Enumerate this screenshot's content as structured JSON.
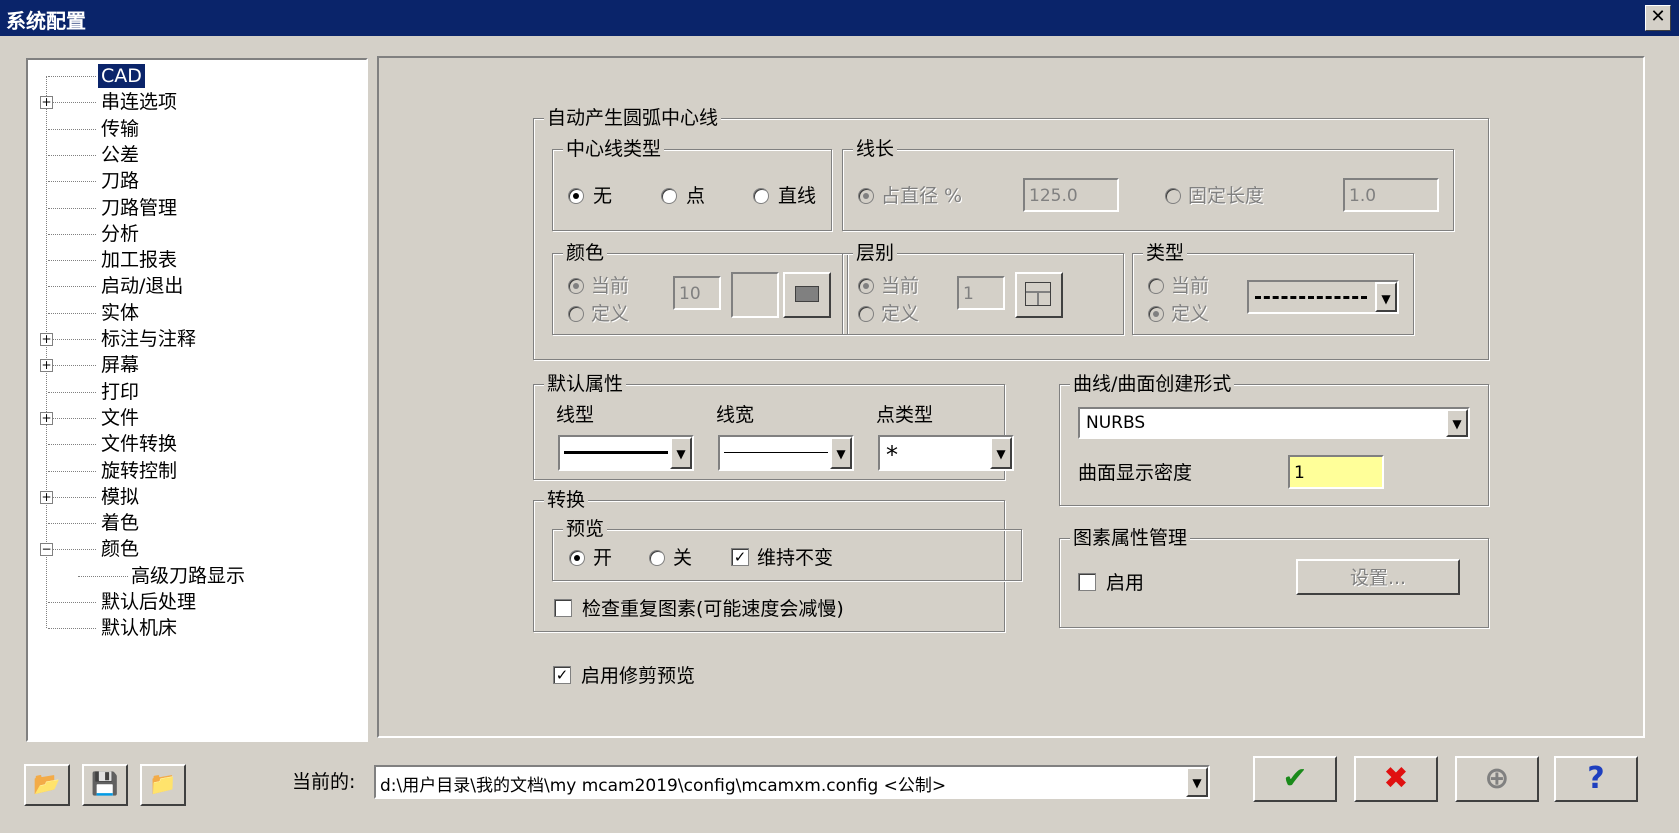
{
  "window": {
    "title": "系统配置",
    "close_glyph": "✕"
  },
  "tree": [
    {
      "label": "CAD",
      "expander": "",
      "selected": true
    },
    {
      "label": "串连选项",
      "expander": "+"
    },
    {
      "label": "传输",
      "expander": ""
    },
    {
      "label": "公差",
      "expander": ""
    },
    {
      "label": "刀路",
      "expander": ""
    },
    {
      "label": "刀路管理",
      "expander": ""
    },
    {
      "label": "分析",
      "expander": ""
    },
    {
      "label": "加工报表",
      "expander": ""
    },
    {
      "label": "启动/退出",
      "expander": ""
    },
    {
      "label": "实体",
      "expander": ""
    },
    {
      "label": "标注与注释",
      "expander": "+"
    },
    {
      "label": "屏幕",
      "expander": "+"
    },
    {
      "label": "打印",
      "expander": ""
    },
    {
      "label": "文件",
      "expander": "+"
    },
    {
      "label": "文件转换",
      "expander": ""
    },
    {
      "label": "旋转控制",
      "expander": ""
    },
    {
      "label": "模拟",
      "expander": "+"
    },
    {
      "label": "着色",
      "expander": ""
    },
    {
      "label": "颜色",
      "expander": "−"
    },
    {
      "label": "高级刀路显示",
      "expander": "",
      "child": true
    },
    {
      "label": "默认后处理",
      "expander": ""
    },
    {
      "label": "默认机床",
      "expander": ""
    }
  ],
  "arc": {
    "title": "自动产生圆弧中心线",
    "centerline_type": {
      "title": "中心线类型",
      "options": [
        "无",
        "点",
        "直线"
      ],
      "selected": "无"
    },
    "length": {
      "title": "线长",
      "pct_label": "占直径 %",
      "pct_value": "125.0",
      "fixed_label": "固定长度",
      "fixed_value": "1.0"
    },
    "color": {
      "title": "颜色",
      "current": "当前",
      "define": "定义",
      "value": "10"
    },
    "level": {
      "title": "层别",
      "current": "当前",
      "define": "定义",
      "value": "1"
    },
    "type": {
      "title": "类型",
      "current": "当前",
      "define": "定义"
    }
  },
  "defaults": {
    "title": "默认属性",
    "linetype_label": "线型",
    "linewidth_label": "线宽",
    "pointtype_label": "点类型",
    "point_glyph": "*"
  },
  "surface": {
    "title": "曲线/曲面创建形式",
    "form_value": "NURBS",
    "density_label": "曲面显示密度",
    "density_value": "1"
  },
  "convert": {
    "title": "转换",
    "preview_title": "预览",
    "on": "开",
    "off": "关",
    "keep": "维持不变",
    "check_dup": "检查重复图素(可能速度会减慢)"
  },
  "entity_attr": {
    "title": "图素属性管理",
    "enable": "启用",
    "settings": "设置..."
  },
  "trim_preview": "启用修剪预览",
  "bottom": {
    "current_label": "当前的:",
    "path": "d:\\用户目录\\我的文档\\my mcam2019\\config\\mcamxm.config <公制>"
  },
  "colors": {
    "titlebar": "#0a246a",
    "face": "#d4d0c8",
    "highlight_field": "#ffff99",
    "ok_green": "#1a8a1a",
    "cancel_red": "#e01010"
  },
  "icons": [
    "folder-open-icon",
    "save-icon",
    "folder-merge-icon",
    "checkmark-icon",
    "cross-icon",
    "plus-circle-icon",
    "question-icon"
  ]
}
